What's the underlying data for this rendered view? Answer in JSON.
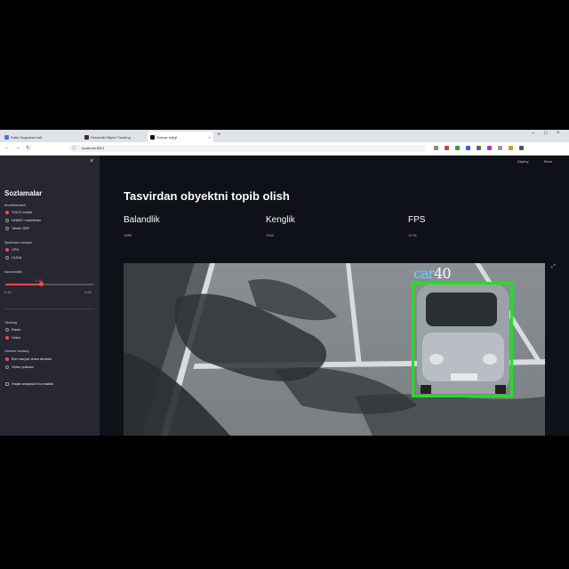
{
  "browser": {
    "tabs": [
      {
        "title": "Sofia Snapshot nafl",
        "left": 0
      },
      {
        "title": "Streamlit Object Tracking",
        "left": 0
      },
      {
        "title": "Sarwar mlfpjt",
        "left": 0
      }
    ],
    "url": "localhost:8501"
  },
  "sidebar": {
    "title": "Sozlamalar",
    "model_group": {
      "label": "Modeltanlash",
      "options": [
        "YOLO model",
        "GHMIC modelidan",
        "Tavsiv SRF"
      ],
      "selected": 0
    },
    "tracker_group": {
      "label": "Qurilmani tanlash",
      "options": [
        "CPU",
        "CUDA"
      ],
      "selected": 0
    },
    "confidence": {
      "label": "Ishonchlilik",
      "value": "0.45",
      "fraction": 0.4,
      "min": "0.10",
      "max": "1.00"
    },
    "source_group": {
      "label": "Tanlang",
      "options": [
        "Rasm",
        "Video"
      ],
      "selected": 1
    },
    "video_group": {
      "label": "Videoni tanlang",
      "options": [
        "Bor mavjud video tanlash",
        "Video yuklash"
      ],
      "selected": 0
    },
    "checkbox_label": "Faqat aniqlashni ko'rsatish"
  },
  "main": {
    "header_right": [
      "Deploy",
      "More"
    ],
    "title": "Tasvirdan obyektni topib olish",
    "metrics": [
      {
        "label": "Balandlik",
        "value": "1080"
      },
      {
        "label": "Kenglik",
        "value": "1920"
      },
      {
        "label": "FPS",
        "value": "12.91"
      }
    ],
    "detection": {
      "label": "car",
      "score": "40"
    }
  },
  "colors": {
    "accent": "#ff4b4b",
    "box": "#22e022",
    "label_text": "#64d2ff"
  }
}
